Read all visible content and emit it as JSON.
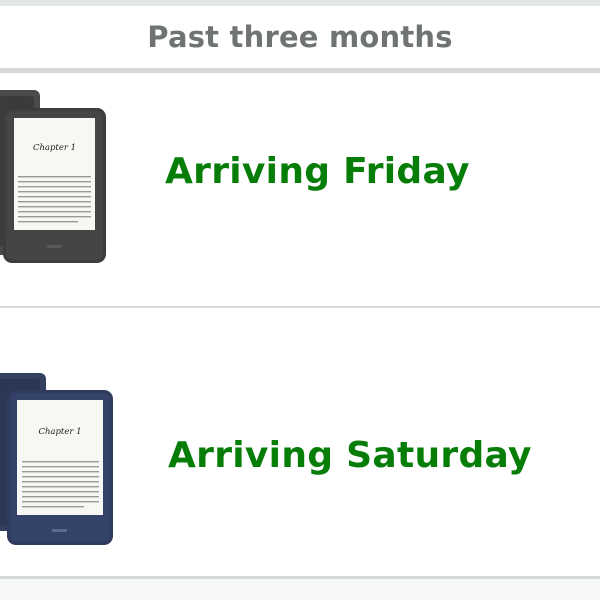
{
  "section": {
    "title": "Past three months"
  },
  "orders": [
    {
      "status": "Arriving Friday",
      "product_icon": "kindle-ereader-black-icon",
      "screen_heading": "Chapter 1"
    },
    {
      "status": "Arriving Saturday",
      "product_icon": "kindle-ereader-denim-icon",
      "screen_heading": "Chapter 1"
    }
  ],
  "colors": {
    "status_green": "#067d06",
    "header_gray": "#6f7373",
    "divider": "#d5d9d9",
    "device_black": "#3a3a3a",
    "device_blue": "#2c3a5c"
  }
}
